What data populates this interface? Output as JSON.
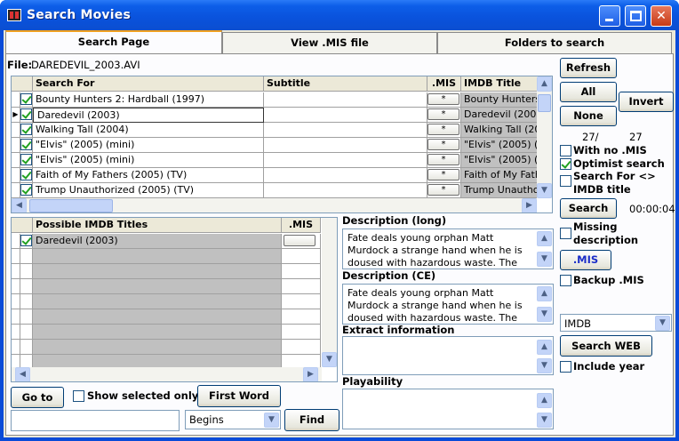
{
  "window": {
    "title": "Search Movies"
  },
  "tabs": [
    "Search Page",
    "View .MIS file",
    "Folders to search"
  ],
  "file": {
    "label": "File:",
    "value": "DAREDEVIL_2003.AVI"
  },
  "search_grid": {
    "headers": [
      "Search For",
      "Subtitle",
      ".MIS",
      "IMDB Title"
    ],
    "rows": [
      {
        "search": "Bounty Hunters 2: Hardball (1997)",
        "mis": "*",
        "imdb": "Bounty Hunters"
      },
      {
        "search": "Daredevil (2003)",
        "mis": "*",
        "imdb": "Daredevil (2003)"
      },
      {
        "search": "Walking Tall (2004)",
        "mis": "*",
        "imdb": "Walking Tall (200"
      },
      {
        "search": "\"Elvis\" (2005) (mini)",
        "mis": "*",
        "imdb": "\"Elvis\" (2005) (m"
      },
      {
        "search": "\"Elvis\" (2005) (mini)",
        "mis": "*",
        "imdb": "\"Elvis\" (2005) (m"
      },
      {
        "search": "Faith of My Fathers (2005) (TV)",
        "mis": "*",
        "imdb": "Faith of My Fathe"
      },
      {
        "search": "Trump Unauthorized (2005) (TV)",
        "mis": "*",
        "imdb": "Trump Unauthori"
      }
    ]
  },
  "right_panel": {
    "refresh": "Refresh",
    "all": "All",
    "invert": "Invert",
    "none": "None",
    "count_selected": "27/",
    "count_total": "27",
    "with_no_mis": "With no .MIS",
    "optimist": "Optimist search",
    "search_for_line1": "Search For <>",
    "search_for_line2": "IMDB title",
    "search": "Search",
    "timer": "00:00:04",
    "missing_line1": "Missing",
    "missing_line2": "description",
    "mis_button": ".MIS",
    "backup": "Backup .MIS",
    "source_select": "IMDB",
    "search_web": "Search WEB",
    "include_year": "Include year"
  },
  "possible_grid": {
    "headers": [
      "Possible IMDB Titles",
      ".MIS"
    ],
    "rows": [
      {
        "title": "Daredevil (2003)"
      }
    ]
  },
  "descriptions": {
    "long_label": "Description (long)",
    "long_text": "Fate deals young orphan Matt Murdock a strange hand when he is doused with hazardous waste. The",
    "ce_label": "Description (CE)",
    "ce_text": "Fate deals young orphan Matt Murdock a strange hand when he is doused with hazardous waste. The",
    "extract_label": "Extract information",
    "playability_label": "Playability"
  },
  "bottom": {
    "goto": "Go to",
    "show_selected": "Show selected only",
    "first_word": "First Word",
    "begins": "Begins",
    "find": "Find"
  }
}
